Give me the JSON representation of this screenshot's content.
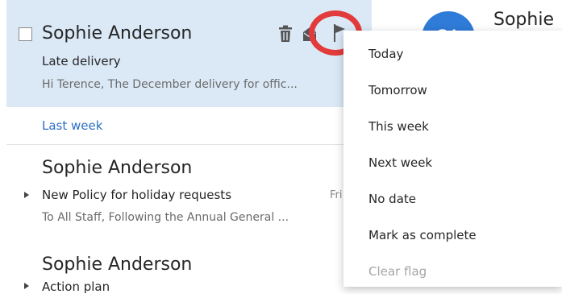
{
  "mail_list": {
    "selected_message": {
      "sender": "Sophie Anderson",
      "subject": "Late delivery",
      "preview": "Hi Terence,   The December delivery for offic..."
    },
    "group_header": "Last week",
    "messages": [
      {
        "sender": "Sophie Anderson",
        "subject": "New Policy for holiday requests",
        "preview": "To All Staff,   Following the Annual General ...",
        "date": "Fri"
      },
      {
        "sender": "Sophie Anderson",
        "subject": "Action plan"
      }
    ]
  },
  "icons": {
    "delete": "trash-icon",
    "read": "envelope-open-icon",
    "flag": "flag-icon",
    "more": "chevron-down-icon"
  },
  "flag_menu": {
    "items": [
      {
        "label": "Today",
        "enabled": true
      },
      {
        "label": "Tomorrow",
        "enabled": true
      },
      {
        "label": "This week",
        "enabled": true
      },
      {
        "label": "Next week",
        "enabled": true
      },
      {
        "label": "No date",
        "enabled": true
      },
      {
        "label": "Mark as complete",
        "enabled": true
      },
      {
        "label": "Clear flag",
        "enabled": false
      }
    ]
  },
  "reading_pane": {
    "avatar_initials": "SA",
    "sender_name": "Sophie"
  },
  "colors": {
    "selection": "#dbe9f7",
    "accent": "#2b6fc2",
    "avatar": "#2f7bd8",
    "highlight": "#e23b3b"
  }
}
